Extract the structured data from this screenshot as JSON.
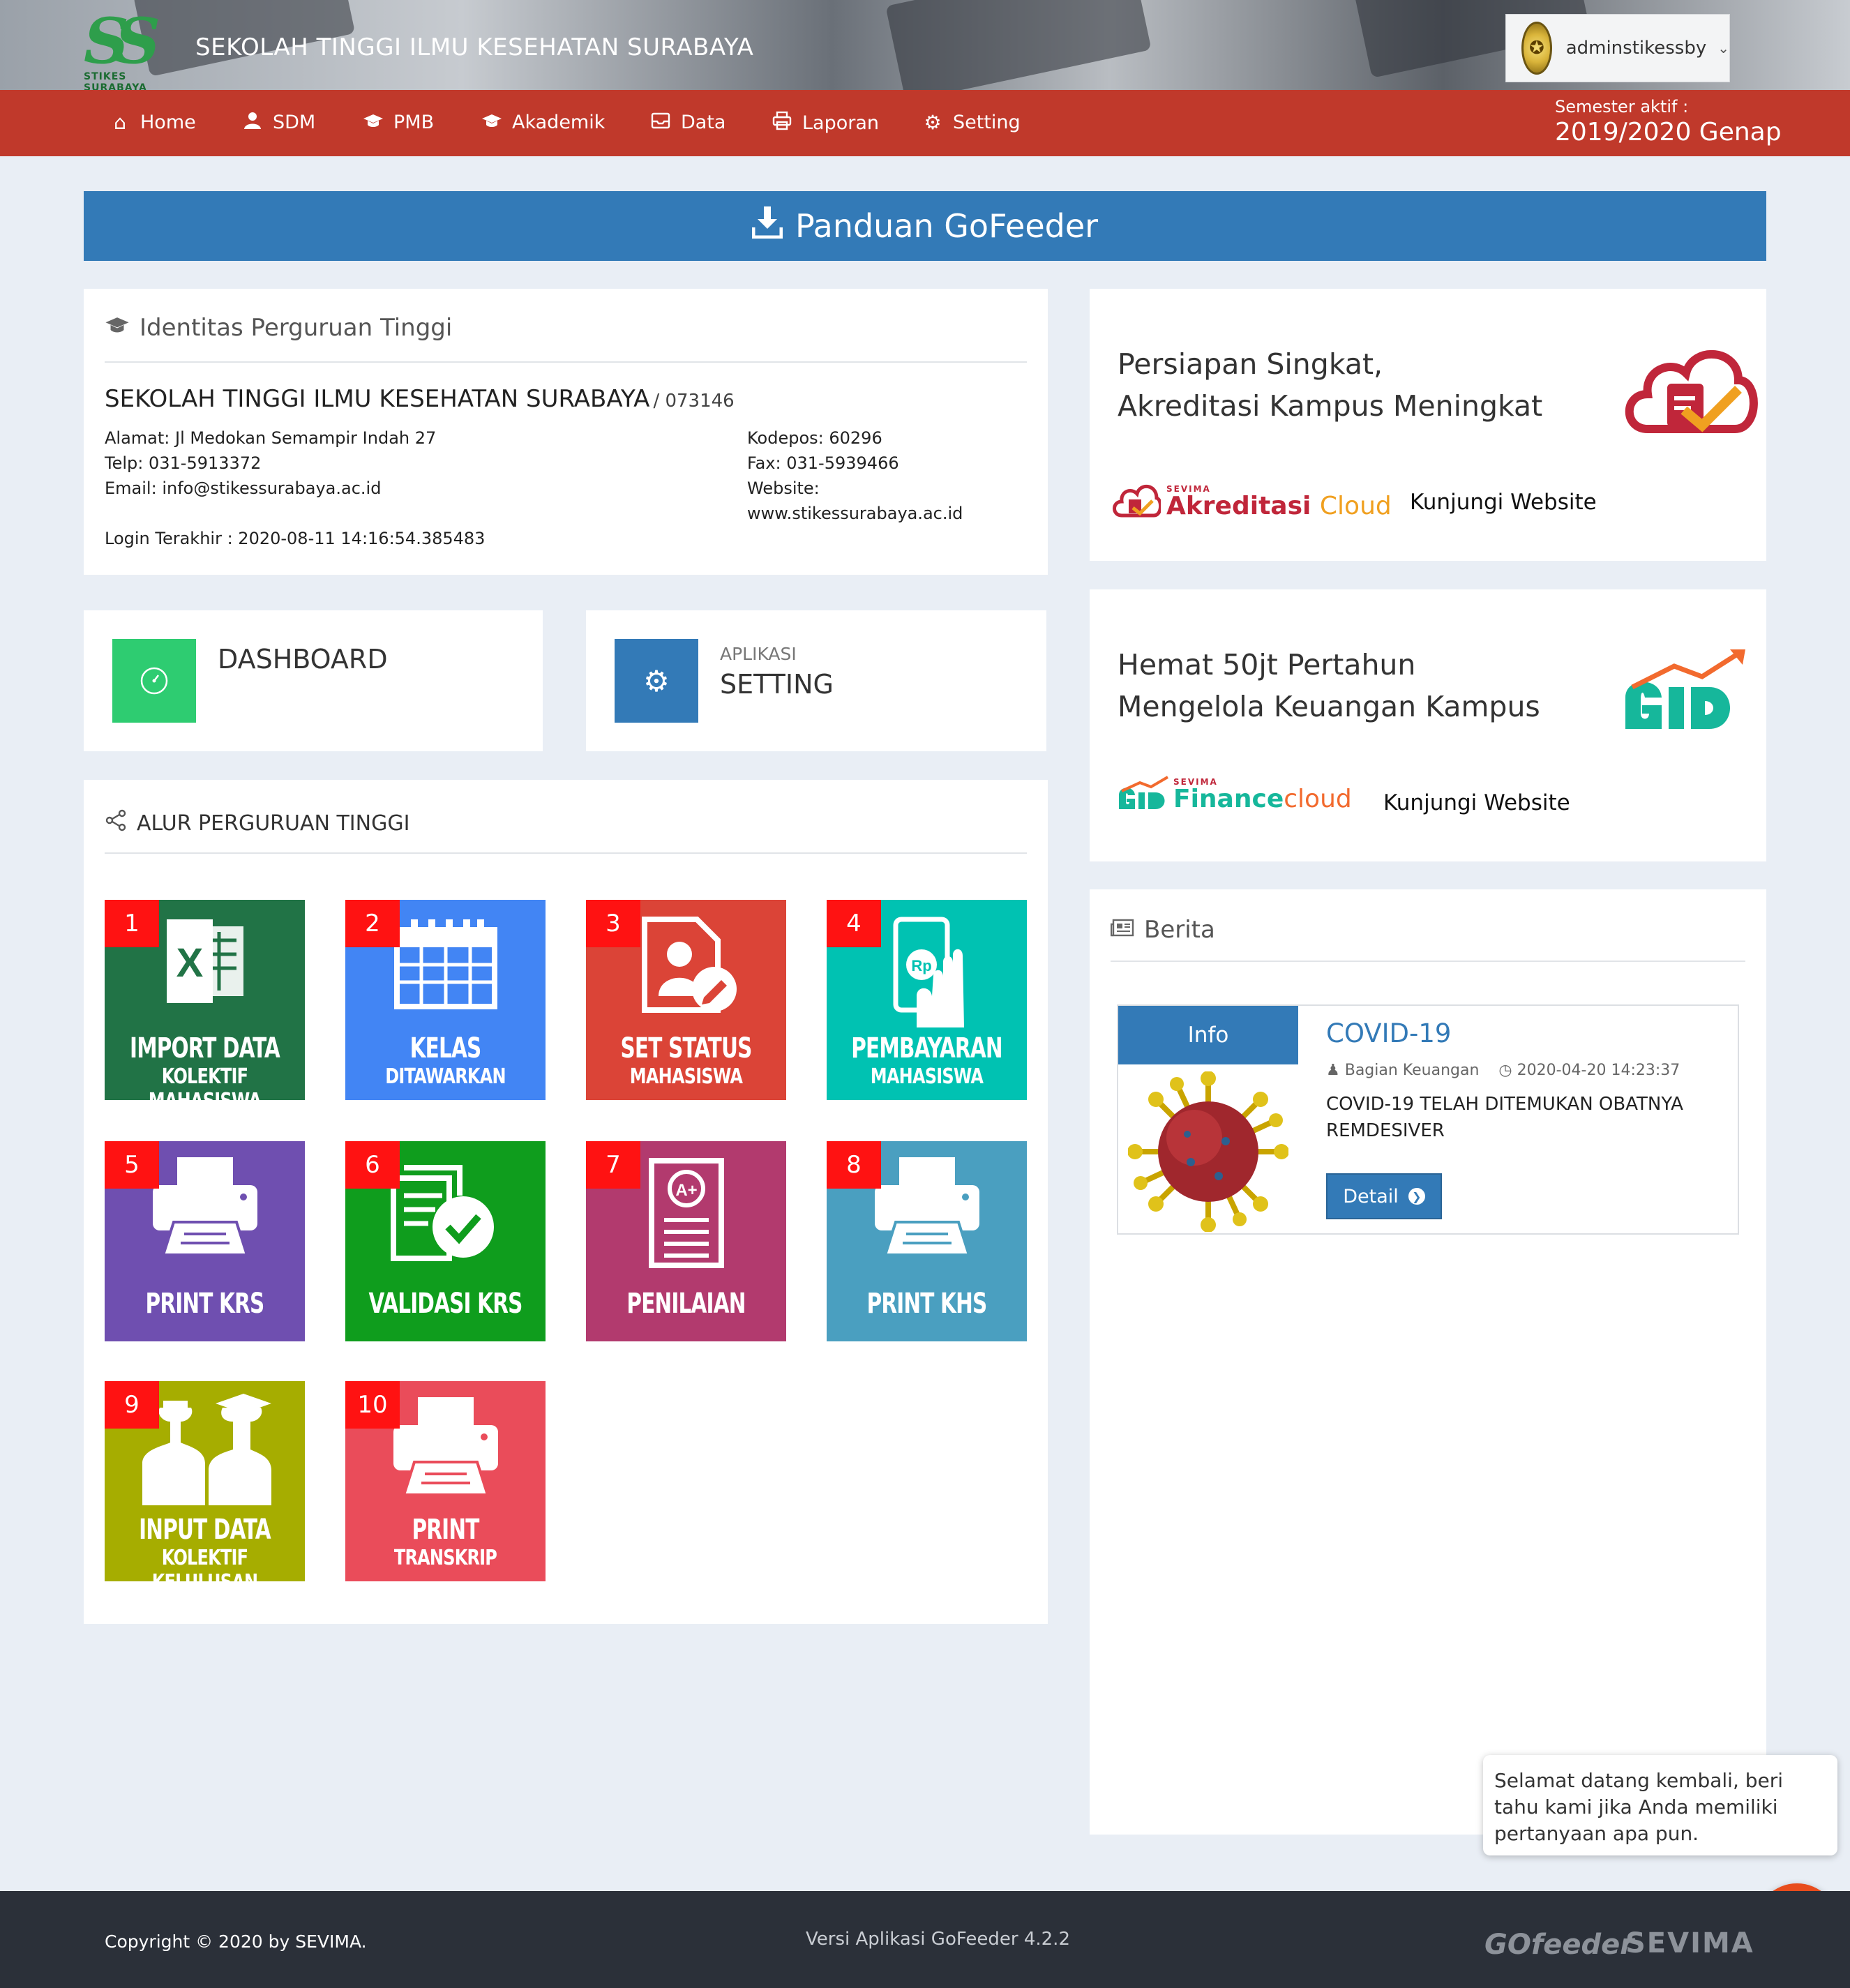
{
  "header": {
    "logo_text": "SS",
    "logo_sub": "STIKES SURABAYA",
    "institution": "SEKOLAH TINGGI ILMU KESEHATAN SURABAYA",
    "user": "adminstikessby"
  },
  "nav": {
    "items": [
      {
        "label": "Home",
        "icon": "home-icon"
      },
      {
        "label": "SDM",
        "icon": "user-icon"
      },
      {
        "label": "PMB",
        "icon": "graduation-cap-icon"
      },
      {
        "label": "Akademik",
        "icon": "graduation-cap-icon"
      },
      {
        "label": "Data",
        "icon": "inbox-icon"
      },
      {
        "label": "Laporan",
        "icon": "printer-icon"
      },
      {
        "label": "Setting",
        "icon": "gear-icon"
      }
    ],
    "semester_label": "Semester aktif :",
    "semester_value": "2019/2020 Genap"
  },
  "panduan": {
    "label": "Panduan GoFeeder"
  },
  "identitas": {
    "title": "Identitas Perguruan Tinggi",
    "name": "SEKOLAH TINGGI ILMU KESEHATAN SURABAYA",
    "code": "/ 073146",
    "alamat_label": "Alamat:",
    "alamat": "Jl Medokan Semampir Indah 27",
    "telp_label": "Telp:",
    "telp": "031-5913372",
    "email_label": "Email:",
    "email": "info@stikessurabaya.ac.id",
    "kodepos_label": "Kodepos:",
    "kodepos": "60296",
    "fax_label": "Fax:",
    "fax": "031-5939466",
    "website_label": "Website:",
    "website": "www.stikessurabaya.ac.id",
    "login_label": "Login Terakhir :",
    "login": "2020-08-11 14:16:54.385483"
  },
  "dashboard": {
    "title": "DASHBOARD"
  },
  "setting": {
    "small": "APLIKASI",
    "title": "SETTING"
  },
  "alur": {
    "title": "ALUR PERGURUAN TINGGI",
    "tiles": [
      {
        "num": "1",
        "l1": "IMPORT DATA",
        "l2": "KOLEKTIF MAHASISWA",
        "color": "#217346"
      },
      {
        "num": "2",
        "l1": "KELAS",
        "l2": "DITAWARKAN",
        "color": "#4285f4"
      },
      {
        "num": "3",
        "l1": "SET STATUS",
        "l2": "MAHASISWA",
        "color": "#db4437"
      },
      {
        "num": "4",
        "l1": "PEMBAYARAN",
        "l2": "MAHASISWA",
        "color": "#00c2b2"
      },
      {
        "num": "5",
        "l1": "PRINT KRS",
        "l2": "",
        "color": "#6f4fb0"
      },
      {
        "num": "6",
        "l1": "VALIDASI KRS",
        "l2": "",
        "color": "#0f9d1d"
      },
      {
        "num": "7",
        "l1": "PENILAIAN",
        "l2": "",
        "color": "#b23a6e"
      },
      {
        "num": "8",
        "l1": "PRINT KHS",
        "l2": "",
        "color": "#4a9fc0"
      },
      {
        "num": "9",
        "l1": "INPUT DATA",
        "l2": "KOLEKTIF KELULUSAN",
        "color": "#a6ad00"
      },
      {
        "num": "10",
        "l1": "PRINT",
        "l2": "TRANSKRIP",
        "color": "#ea4c5a"
      }
    ]
  },
  "promo1": {
    "line1": "Persiapan Singkat,",
    "line2": "Akreditasi Kampus Meningkat",
    "brand_small": "SEVIMA",
    "brand_a": "Akreditasi",
    "brand_b": "Cloud",
    "link": "Kunjungi Website"
  },
  "promo2": {
    "line1": "Hemat 50jt Pertahun",
    "line2": "Mengelola Keuangan Kampus",
    "brand_small": "SEVIMA",
    "brand_a": "Finance",
    "brand_b": "cloud",
    "link": "Kunjungi Website"
  },
  "berita": {
    "title": "Berita",
    "badge": "Info",
    "news_title": "COVID-19",
    "author": "Bagian Keuangan",
    "date": "2020-04-20 14:23:37",
    "body": "COVID-19 TELAH DITEMUKAN OBATNYA REMDESIVER",
    "detail": "Detail"
  },
  "chat": {
    "message": "Selamat datang kembali, beri tahu kami jika Anda memiliki pertanyaan apa pun."
  },
  "footer": {
    "copyright": "Copyright © 2020 by SEVIMA.",
    "version": "Versi Aplikasi GoFeeder 4.2.2",
    "logo1": "GOfeeder",
    "logo2": "SEVIMA"
  },
  "colors": {
    "nav": "#c0392b",
    "primary": "#337ab7",
    "dashboard": "#2ecc71",
    "badge": "#ff1212"
  }
}
